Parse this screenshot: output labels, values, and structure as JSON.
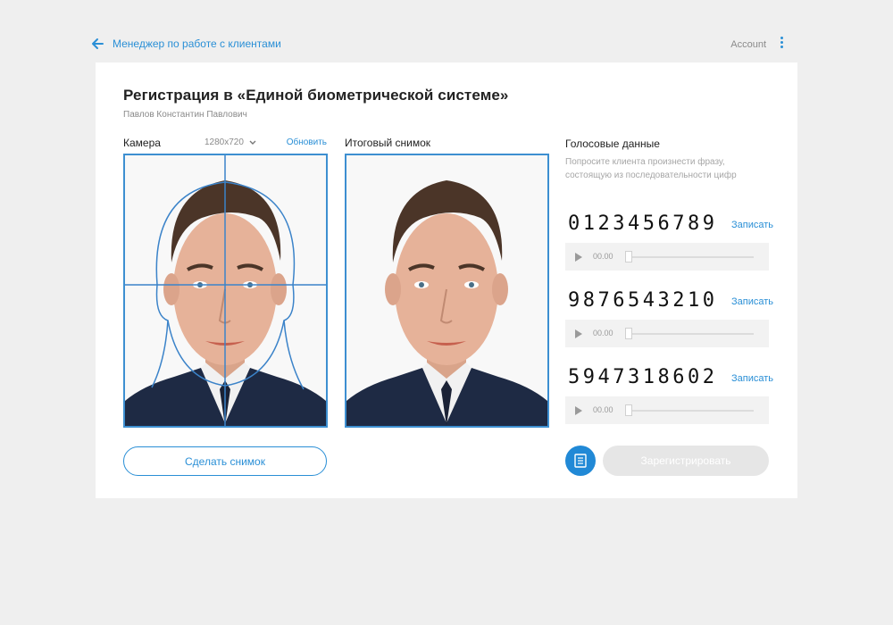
{
  "header": {
    "back_label": "Менеджер по работе с клиентами",
    "account_label": "Account"
  },
  "page": {
    "title": "Регистрация в «Единой биометрической системе»",
    "client_name": "Павлов Константин Павлович"
  },
  "camera": {
    "label": "Камера",
    "resolution": "1280x720",
    "refresh_label": "Обновить",
    "take_photo_label": "Сделать снимок"
  },
  "final_photo": {
    "label": "Итоговый снимок"
  },
  "voice": {
    "title": "Голосовые данные",
    "hint": "Попросите клиента произнести фразу, состоящую из последовательности цифр",
    "sequences": [
      {
        "digits": "0123456789",
        "record_label": "Записать",
        "time": "00.00"
      },
      {
        "digits": "9876543210",
        "record_label": "Записать",
        "time": "00.00"
      },
      {
        "digits": "5947318602",
        "record_label": "Записать",
        "time": "00.00"
      }
    ]
  },
  "actions": {
    "register_label": "Зарегистрировать"
  },
  "colors": {
    "accent": "#2a8fd6",
    "frame": "#3d8fd1",
    "card": "#ffffff",
    "background": "#efefef",
    "disabled": "#e6e6e6"
  },
  "icons": [
    "back-arrow-icon",
    "kebab-menu-icon",
    "chevron-down-icon",
    "play-icon",
    "document-icon"
  ]
}
